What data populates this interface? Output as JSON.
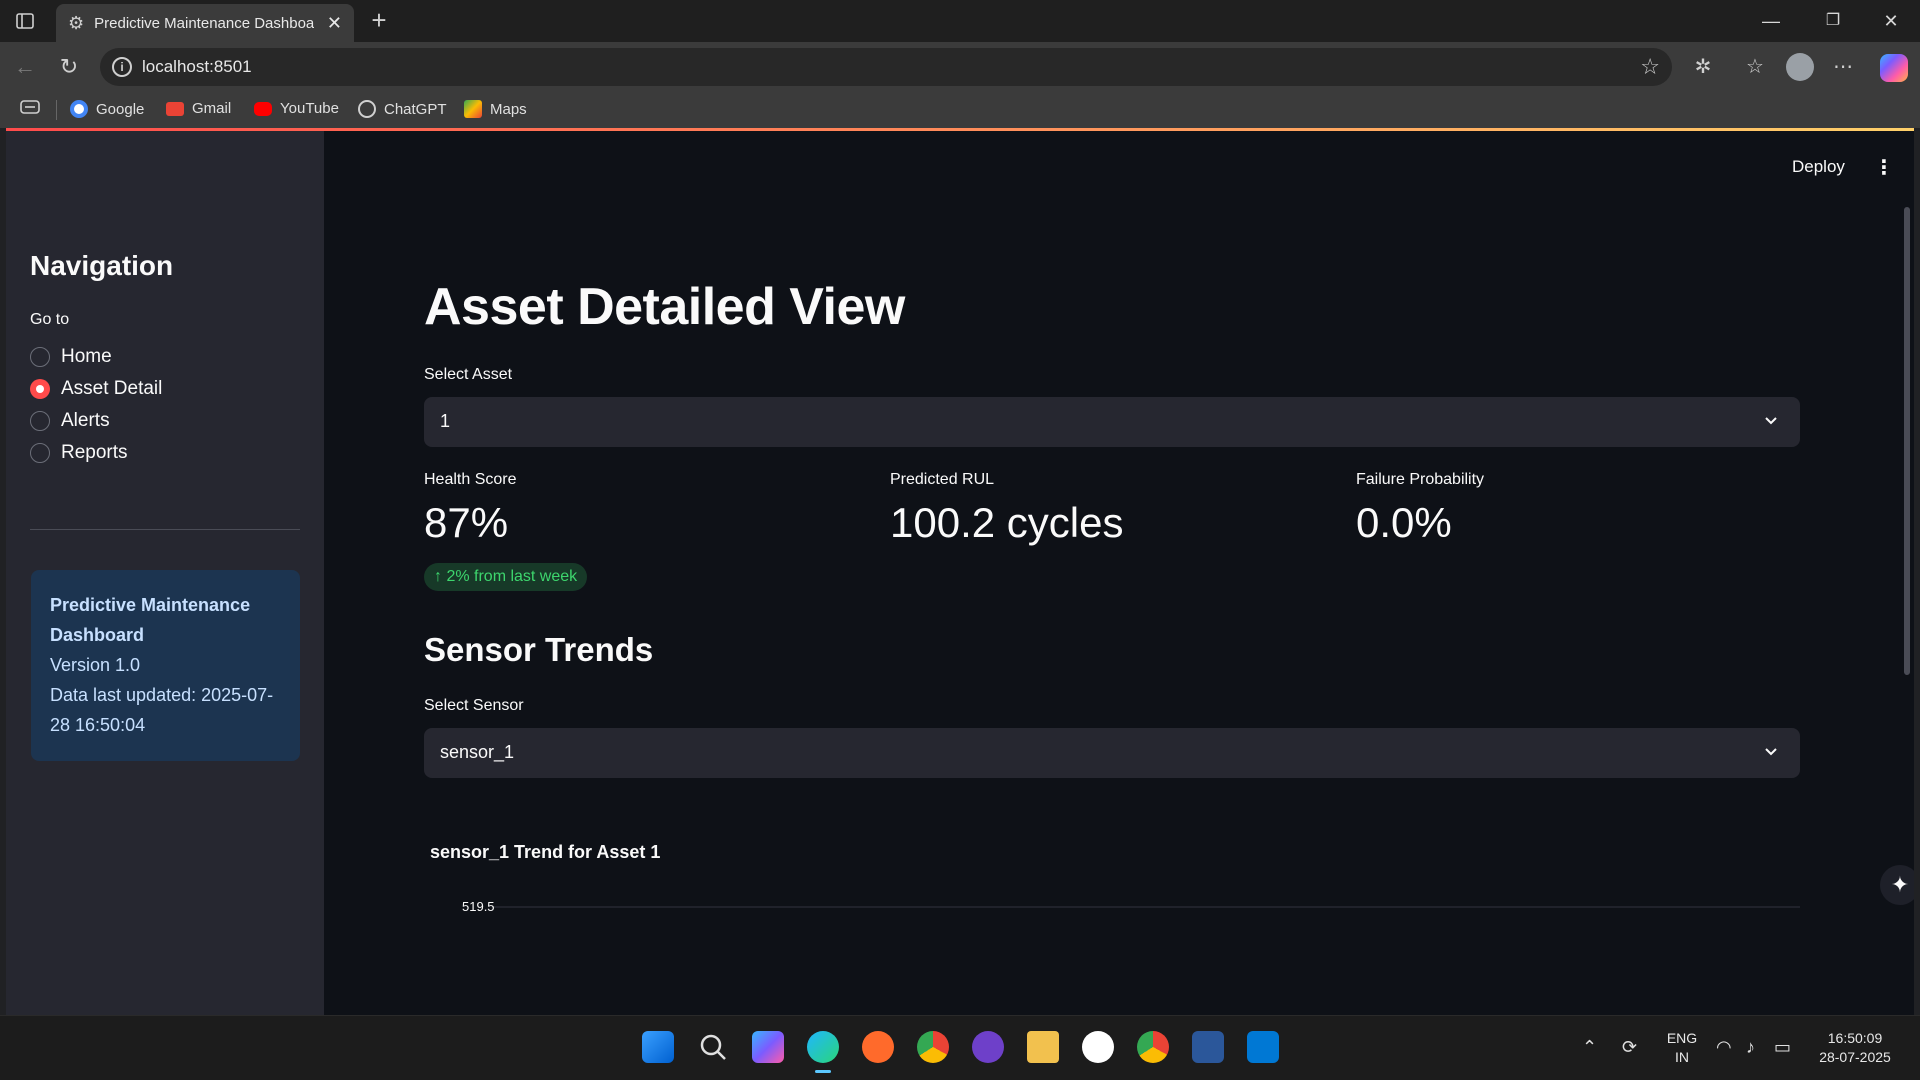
{
  "browser": {
    "tab_title": "Predictive Maintenance Dashboard",
    "new_tab": "+",
    "close": "✕",
    "url": "localhost:8501",
    "bookmarks": [
      {
        "label": "Google",
        "color": "#4285f4"
      },
      {
        "label": "Gmail",
        "color": "#ea4335"
      },
      {
        "label": "YouTube",
        "color": "#ff0000"
      },
      {
        "label": "ChatGPT",
        "color": "#d0d0d0"
      },
      {
        "label": "Maps",
        "color": "#34a853"
      }
    ]
  },
  "app": {
    "header": {
      "deploy": "Deploy",
      "menu": "⋮"
    },
    "sidebar": {
      "title": "Navigation",
      "goto_label": "Go to",
      "options": [
        "Home",
        "Asset Detail",
        "Alerts",
        "Reports"
      ],
      "selected": "Asset Detail",
      "info": {
        "title": "Predictive Maintenance Dashboard",
        "version": "Version 1.0",
        "updated": "Data last updated: 2025-07-28 16:50:04"
      }
    },
    "main": {
      "title": "Asset Detailed View",
      "select_asset_label": "Select Asset",
      "select_asset_value": "1",
      "metrics": [
        {
          "label": "Health Score",
          "value": "87%"
        },
        {
          "label": "Predicted RUL",
          "value": "100.2 cycles"
        },
        {
          "label": "Failure Probability",
          "value": "0.0%"
        }
      ],
      "delta": "↑ 2% from last week",
      "section_title": "Sensor Trends",
      "select_sensor_label": "Select Sensor",
      "select_sensor_value": "sensor_1",
      "chart_title": "sensor_1 Trend for Asset 1"
    }
  },
  "chart_data": {
    "type": "line",
    "title": "sensor_1 Trend for Asset 1",
    "y_ticks": [
      519.5
    ],
    "grid": true
  },
  "taskbar": {
    "lang": "ENG",
    "region": "IN",
    "time": "16:50:09",
    "date": "28-07-2025",
    "colors": {
      "accent": "#ff4b4b",
      "success": "#3dd56d",
      "info_bg": "#1c3450"
    }
  }
}
